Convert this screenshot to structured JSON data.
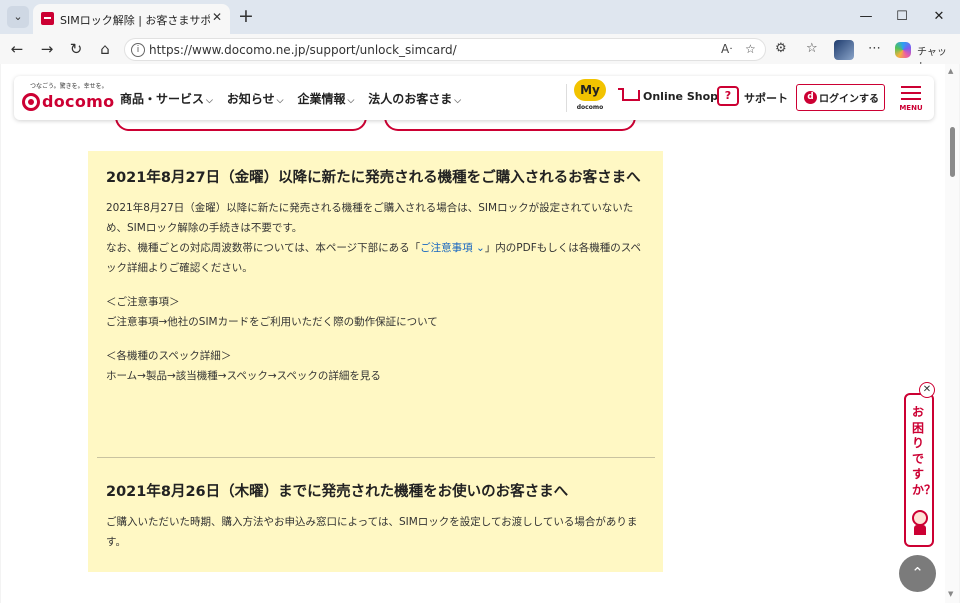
{
  "browser": {
    "tab_title": "SIMロック解除 | お客さまサポート | NT",
    "url": "https://www.docomo.ne.jp/support/unlock_simcard/",
    "copilot_label": "チャット"
  },
  "header": {
    "logo_tagline": "つなごう。驚きを。幸せを。",
    "logo_text": "docomo",
    "nav": [
      {
        "label": "商品・サービス"
      },
      {
        "label": "お知らせ"
      },
      {
        "label": "企業情報"
      },
      {
        "label": "法人のお客さま"
      }
    ],
    "my_label": "My",
    "my_sub": "docomo",
    "online_shop": "Online Shop",
    "support": "サポート",
    "login": "ログインする",
    "menu": "MENU"
  },
  "content": {
    "section1": {
      "heading": "2021年8月27日（金曜）以降に新たに発売される機種をご購入されるお客さまへ",
      "body_1": "2021年8月27日（金曜）以降に新たに発売される機種をご購入される場合は、SIMロックが設定されていないため、SIMロック解除の手続きは不要です。",
      "body_2_pre": "なお、機種ごとの対応周波数帯については、本ページ下部にある「",
      "body_2_link": "ご注意事項",
      "body_2_post": "」内のPDFもしくは各機種のスペック詳細よりご確認ください。",
      "note1_title": "＜ご注意事項＞",
      "note1_path": "ご注意事項→他社のSIMカードをご利用いただく際の動作保証について",
      "note2_title": "＜各機種のスペック詳細＞",
      "note2_path": "ホーム→製品→該当機種→スペック→スペックの詳細を見る"
    },
    "section2": {
      "heading": "2021年8月26日（木曜）までに発売された機種をお使いのお客さまへ",
      "body": "ご購入いただいた時期、購入方法やお申込み窓口によっては、SIMロックを設定してお渡ししている場合があります。"
    }
  },
  "help_tab": {
    "text": "お困りですか？"
  },
  "colors": {
    "brand": "#cc0033",
    "content_bg": "#fff8c4",
    "my_yellow": "#f2c300"
  }
}
